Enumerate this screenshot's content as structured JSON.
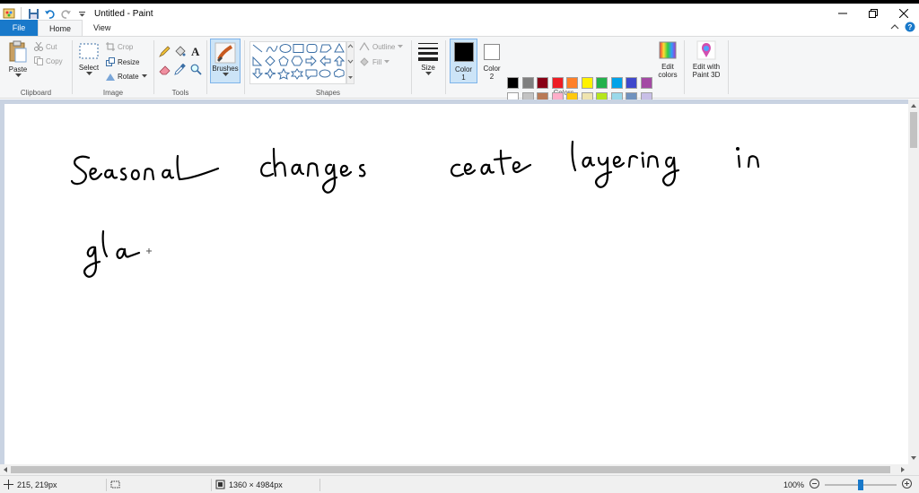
{
  "window": {
    "title": "Untitled - Paint"
  },
  "tabs": [
    {
      "label": "File"
    },
    {
      "label": "Home"
    },
    {
      "label": "View"
    }
  ],
  "ribbon": {
    "clipboard": {
      "group_label": "Clipboard",
      "paste": "Paste",
      "cut": "Cut",
      "copy": "Copy"
    },
    "image": {
      "group_label": "Image",
      "select": "Select",
      "crop": "Crop",
      "resize": "Resize",
      "rotate": "Rotate"
    },
    "tools": {
      "group_label": "Tools"
    },
    "brushes": {
      "label": "Brushes"
    },
    "shapes": {
      "group_label": "Shapes",
      "outline": "Outline",
      "fill": "Fill"
    },
    "size": {
      "label": "Size"
    },
    "colors": {
      "group_label": "Colors",
      "color1": "Color",
      "color1_num": "1",
      "color2": "Color",
      "color2_num": "2",
      "color1_value": "#000000",
      "color2_value": "#ffffff",
      "edit_colors_1": "Edit",
      "edit_colors_2": "colors",
      "palette_row1": [
        "#000000",
        "#7f7f7f",
        "#880015",
        "#ed1c24",
        "#ff7f27",
        "#fff200",
        "#22b14c",
        "#00a2e8",
        "#3f48cc",
        "#a349a4"
      ],
      "palette_row2": [
        "#ffffff",
        "#c3c3c3",
        "#b97a57",
        "#ffaec9",
        "#ffc90e",
        "#efe4b0",
        "#b5e61d",
        "#99d9ea",
        "#7092be",
        "#c8bfe7"
      ]
    },
    "paint3d": {
      "line1": "Edit with",
      "line2": "Paint 3D"
    }
  },
  "canvas": {
    "handwriting_line1": "Seasonal changes ceate layering in",
    "handwriting_line2": "gla"
  },
  "status": {
    "cursor_pos": "215, 219px",
    "image_size": "1360 × 4984px",
    "zoom": "100%",
    "zoom_fraction": 0.5
  }
}
